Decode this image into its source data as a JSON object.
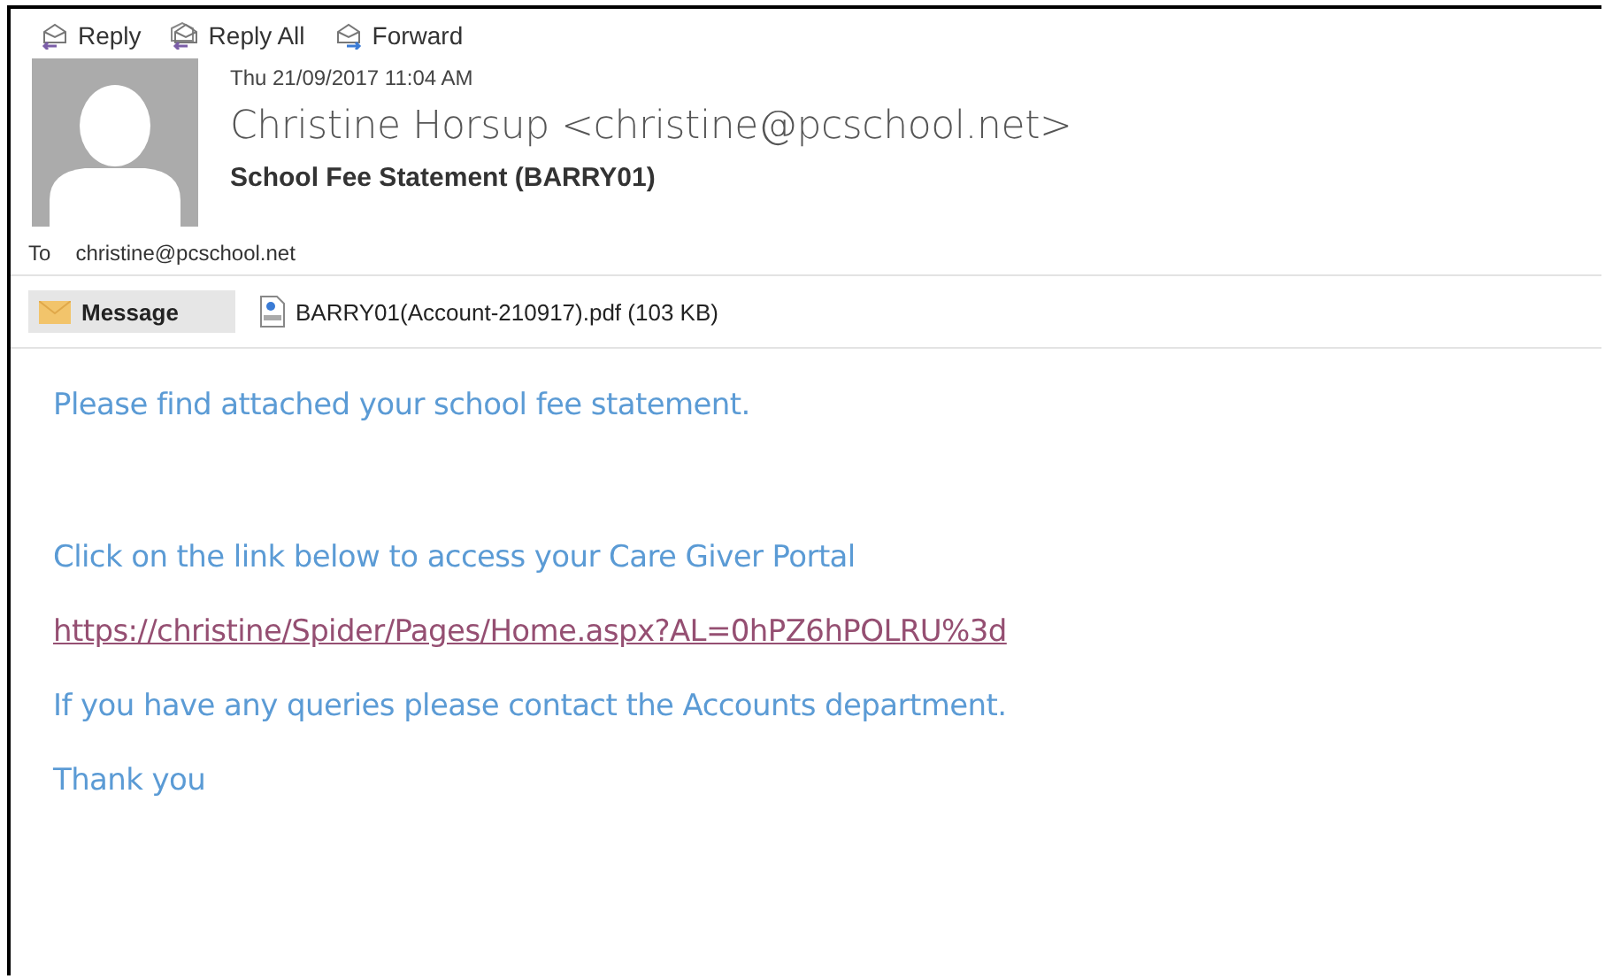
{
  "actions": [
    {
      "label": "Reply",
      "kind": "reply"
    },
    {
      "label": "Reply All",
      "kind": "reply_all"
    },
    {
      "label": "Forward",
      "kind": "forward"
    }
  ],
  "header": {
    "date": "Thu 21/09/2017 11:04 AM",
    "sender": "Christine Horsup <christine@pcschool.net>",
    "subject": "School Fee Statement (BARRY01)",
    "to_label": "To",
    "to": "christine@pcschool.net"
  },
  "attachments": [
    {
      "label": "Message",
      "kind": "message",
      "selected": true
    },
    {
      "label": "BARRY01(Account-210917).pdf (103 KB)",
      "kind": "pdf",
      "selected": false
    }
  ],
  "body": [
    {
      "kind": "text",
      "text": "Please find attached your school fee statement."
    },
    {
      "kind": "gap"
    },
    {
      "kind": "text",
      "text": "Click on the link below to access your Care Giver Portal"
    },
    {
      "kind": "link",
      "text": "https://christine/Spider/Pages/Home.aspx?AL=0hPZ6hPOLRU%3d"
    },
    {
      "kind": "text",
      "text": "If you have any queries please contact the Accounts department."
    },
    {
      "kind": "text",
      "text": "Thank you"
    }
  ]
}
